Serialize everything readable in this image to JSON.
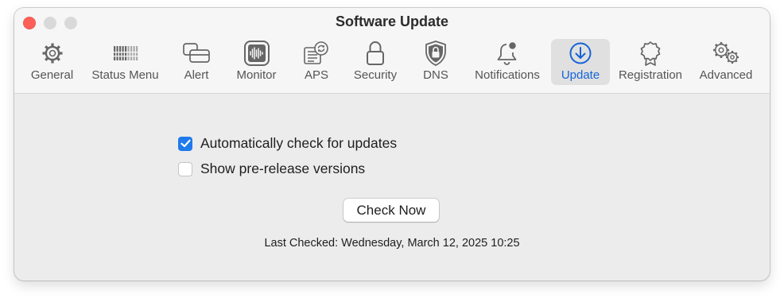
{
  "window": {
    "title": "Software Update"
  },
  "toolbar": {
    "tabs": [
      {
        "label": "General",
        "icon": "gear-icon"
      },
      {
        "label": "Status Menu",
        "icon": "status-menu-icon"
      },
      {
        "label": "Alert",
        "icon": "alert-window-icon"
      },
      {
        "label": "Monitor",
        "icon": "monitor-waveform-icon"
      },
      {
        "label": "APS",
        "icon": "aps-document-icon"
      },
      {
        "label": "Security",
        "icon": "lock-icon"
      },
      {
        "label": "DNS",
        "icon": "shield-lock-icon"
      },
      {
        "label": "Notifications",
        "icon": "bell-icon"
      },
      {
        "label": "Update",
        "icon": "download-arrow-icon",
        "selected": true
      },
      {
        "label": "Registration",
        "icon": "badge-icon"
      },
      {
        "label": "Advanced",
        "icon": "gears-icon"
      }
    ]
  },
  "settings": {
    "auto_check": {
      "label": "Automatically check for updates",
      "checked": true
    },
    "prerelease": {
      "label": "Show pre-release versions",
      "checked": false
    }
  },
  "actions": {
    "check_now_label": "Check Now"
  },
  "status": {
    "last_checked": "Last Checked: Wednesday, March 12, 2025 10:25"
  },
  "colors": {
    "accent": "#1f7aec",
    "selected_tab_text": "#1464d7",
    "close_button": "#fe5f57"
  }
}
